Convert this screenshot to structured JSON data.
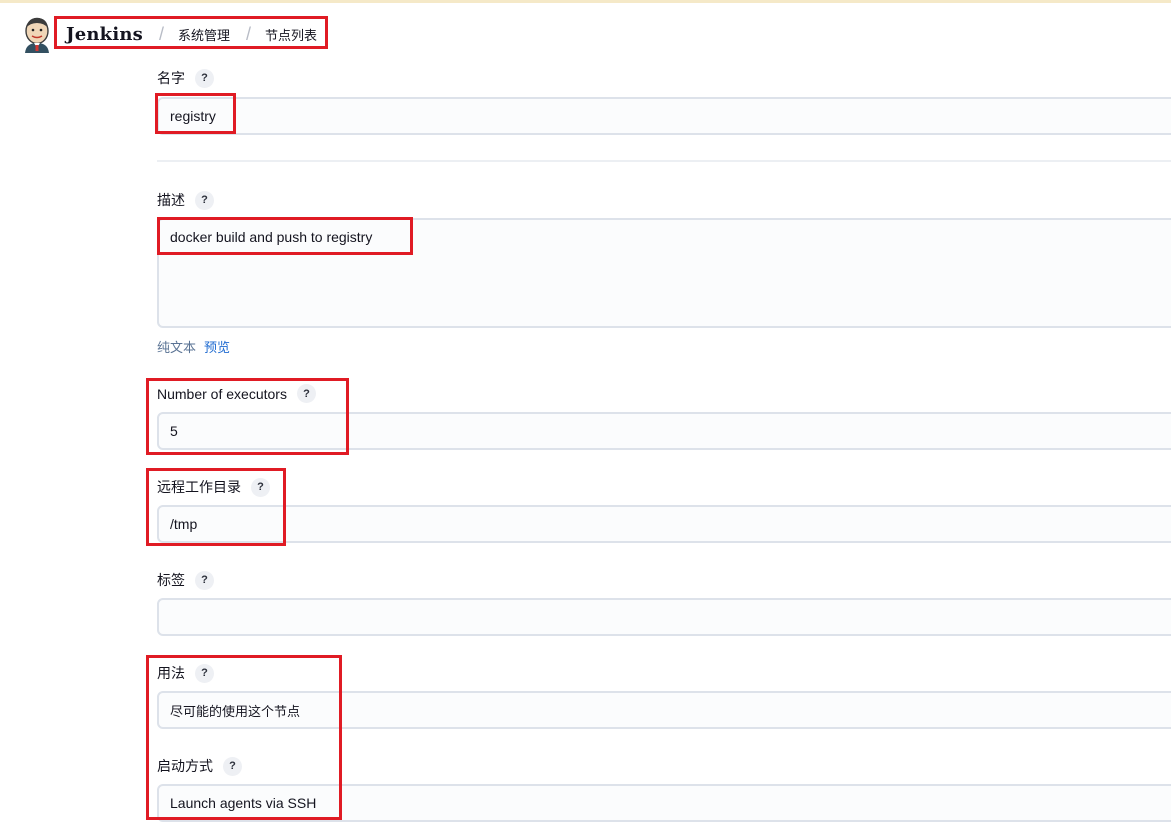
{
  "header": {
    "brand": "Jenkins",
    "breadcrumbs": [
      "系统管理",
      "节点列表"
    ],
    "separator": "/"
  },
  "form": {
    "name": {
      "label": "名字",
      "value": "registry"
    },
    "description": {
      "label": "描述",
      "value": "docker build and push to registry"
    },
    "text_format": {
      "plain": "纯文本",
      "preview": "预览"
    },
    "executors": {
      "label": "Number of executors",
      "value": "5"
    },
    "remote_dir": {
      "label": "远程工作目录",
      "value": "/tmp"
    },
    "labels": {
      "label": "标签",
      "value": ""
    },
    "usage": {
      "label": "用法",
      "value": "尽可能的使用这个节点"
    },
    "launch": {
      "label": "启动方式",
      "value": "Launch agents via SSH"
    },
    "help_glyph": "?"
  },
  "colors": {
    "annotation": "#e01b24",
    "link": "#1f6bd1",
    "field_border": "#dde2ea"
  }
}
